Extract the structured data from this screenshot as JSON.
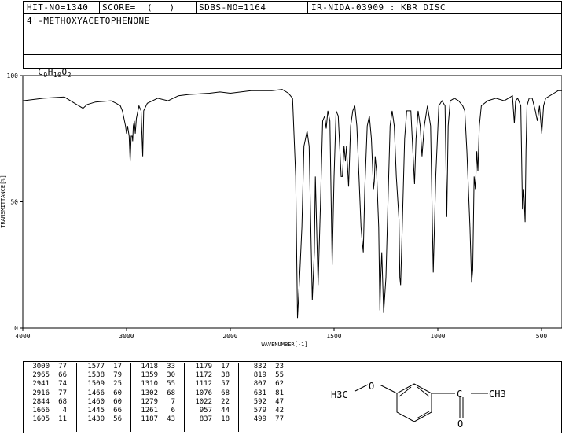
{
  "header": {
    "hit_no": "HIT-NO=1340",
    "score": "SCORE=  (   )",
    "sdbs_no": "SDBS-NO=1164",
    "ir_info": "IR-NIDA-03909 : KBR DISC",
    "compound_name": "4'-METHOXYACETOPHENONE",
    "formula": "C9H10O2"
  },
  "chart_data": {
    "type": "line",
    "title": "",
    "xlabel": "WAVENUMBER[-1]",
    "ylabel": "TRANSMITTANCE[%]",
    "xlim": [
      4000,
      400
    ],
    "ylim": [
      0,
      100
    ],
    "x_ticks": [
      "4000",
      "3000",
      "2000",
      "1500",
      "1000",
      "500"
    ],
    "y_ticks": [
      "100",
      "50",
      "0"
    ],
    "grid": false,
    "series": [
      {
        "points": [
          [
            4000,
            90
          ],
          [
            3800,
            91
          ],
          [
            3600,
            91.5
          ],
          [
            3500,
            89
          ],
          [
            3420,
            87
          ],
          [
            3380,
            88.5
          ],
          [
            3300,
            89.5
          ],
          [
            3150,
            90
          ],
          [
            3100,
            89
          ],
          [
            3060,
            88
          ],
          [
            3040,
            86
          ],
          [
            3010,
            80
          ],
          [
            3000,
            77
          ],
          [
            2990,
            80
          ],
          [
            2975,
            76
          ],
          [
            2965,
            66
          ],
          [
            2955,
            76
          ],
          [
            2945,
            76
          ],
          [
            2941,
            74
          ],
          [
            2935,
            80
          ],
          [
            2925,
            82
          ],
          [
            2916,
            77
          ],
          [
            2905,
            83
          ],
          [
            2880,
            88
          ],
          [
            2860,
            86
          ],
          [
            2844,
            68
          ],
          [
            2835,
            86
          ],
          [
            2800,
            89
          ],
          [
            2700,
            91
          ],
          [
            2600,
            90
          ],
          [
            2500,
            92
          ],
          [
            2400,
            92.5
          ],
          [
            2200,
            93
          ],
          [
            2100,
            93.5
          ],
          [
            2000,
            93
          ],
          [
            1900,
            94
          ],
          [
            1800,
            94
          ],
          [
            1750,
            94.5
          ],
          [
            1720,
            93
          ],
          [
            1700,
            91
          ],
          [
            1685,
            60
          ],
          [
            1676,
            4
          ],
          [
            1666,
            20
          ],
          [
            1655,
            40
          ],
          [
            1645,
            72
          ],
          [
            1630,
            78
          ],
          [
            1620,
            72
          ],
          [
            1605,
            11
          ],
          [
            1595,
            30
          ],
          [
            1590,
            60
          ],
          [
            1577,
            17
          ],
          [
            1565,
            50
          ],
          [
            1555,
            82
          ],
          [
            1545,
            84
          ],
          [
            1538,
            79
          ],
          [
            1530,
            86
          ],
          [
            1520,
            82
          ],
          [
            1509,
            25
          ],
          [
            1500,
            60
          ],
          [
            1490,
            86
          ],
          [
            1480,
            84
          ],
          [
            1466,
            60
          ],
          [
            1460,
            60
          ],
          [
            1452,
            72
          ],
          [
            1445,
            66
          ],
          [
            1440,
            72
          ],
          [
            1430,
            56
          ],
          [
            1420,
            80
          ],
          [
            1410,
            86
          ],
          [
            1400,
            88
          ],
          [
            1390,
            80
          ],
          [
            1380,
            60
          ],
          [
            1370,
            40
          ],
          [
            1365,
            35
          ],
          [
            1359,
            30
          ],
          [
            1352,
            55
          ],
          [
            1340,
            80
          ],
          [
            1330,
            84
          ],
          [
            1320,
            75
          ],
          [
            1310,
            55
          ],
          [
            1306,
            58
          ],
          [
            1302,
            68
          ],
          [
            1295,
            62
          ],
          [
            1285,
            40
          ],
          [
            1279,
            7
          ],
          [
            1275,
            20
          ],
          [
            1270,
            30
          ],
          [
            1261,
            6
          ],
          [
            1250,
            20
          ],
          [
            1240,
            50
          ],
          [
            1230,
            80
          ],
          [
            1220,
            86
          ],
          [
            1210,
            80
          ],
          [
            1200,
            60
          ],
          [
            1187,
            43
          ],
          [
            1183,
            20
          ],
          [
            1179,
            17
          ],
          [
            1172,
            38
          ],
          [
            1160,
            75
          ],
          [
            1150,
            86
          ],
          [
            1130,
            86
          ],
          [
            1120,
            70
          ],
          [
            1112,
            57
          ],
          [
            1105,
            75
          ],
          [
            1095,
            86
          ],
          [
            1085,
            80
          ],
          [
            1076,
            68
          ],
          [
            1065,
            80
          ],
          [
            1050,
            88
          ],
          [
            1035,
            80
          ],
          [
            1022,
            22
          ],
          [
            1010,
            60
          ],
          [
            995,
            88
          ],
          [
            980,
            90
          ],
          [
            965,
            88
          ],
          [
            957,
            44
          ],
          [
            950,
            80
          ],
          [
            940,
            90
          ],
          [
            920,
            91
          ],
          [
            900,
            90
          ],
          [
            880,
            88
          ],
          [
            870,
            86
          ],
          [
            860,
            70
          ],
          [
            845,
            40
          ],
          [
            837,
            18
          ],
          [
            832,
            23
          ],
          [
            825,
            60
          ],
          [
            819,
            55
          ],
          [
            812,
            70
          ],
          [
            807,
            62
          ],
          [
            800,
            80
          ],
          [
            790,
            88
          ],
          [
            760,
            90
          ],
          [
            720,
            91
          ],
          [
            680,
            90
          ],
          [
            660,
            91
          ],
          [
            640,
            92
          ],
          [
            631,
            81
          ],
          [
            625,
            90
          ],
          [
            615,
            91
          ],
          [
            600,
            88
          ],
          [
            592,
            47
          ],
          [
            586,
            55
          ],
          [
            579,
            42
          ],
          [
            575,
            70
          ],
          [
            570,
            88
          ],
          [
            560,
            91
          ],
          [
            545,
            91
          ],
          [
            530,
            86
          ],
          [
            520,
            82
          ],
          [
            510,
            88
          ],
          [
            499,
            77
          ],
          [
            490,
            88
          ],
          [
            480,
            91
          ],
          [
            460,
            92
          ],
          [
            440,
            93
          ],
          [
            420,
            94
          ],
          [
            400,
            94
          ]
        ]
      }
    ]
  },
  "peak_table": {
    "columns": [
      [
        [
          "3000",
          "77"
        ],
        [
          "2965",
          "66"
        ],
        [
          "2941",
          "74"
        ],
        [
          "2916",
          "77"
        ],
        [
          "2844",
          "68"
        ],
        [
          "1666",
          "4"
        ],
        [
          "1605",
          "11"
        ]
      ],
      [
        [
          "1577",
          "17"
        ],
        [
          "1538",
          "79"
        ],
        [
          "1509",
          "25"
        ],
        [
          "1466",
          "60"
        ],
        [
          "1460",
          "60"
        ],
        [
          "1445",
          "66"
        ],
        [
          "1430",
          "56"
        ]
      ],
      [
        [
          "1418",
          "33"
        ],
        [
          "1359",
          "30"
        ],
        [
          "1310",
          "55"
        ],
        [
          "1302",
          "68"
        ],
        [
          "1279",
          "7"
        ],
        [
          "1261",
          "6"
        ],
        [
          "1187",
          "43"
        ]
      ],
      [
        [
          "1179",
          "17"
        ],
        [
          "1172",
          "38"
        ],
        [
          "1112",
          "57"
        ],
        [
          "1076",
          "68"
        ],
        [
          "1022",
          "22"
        ],
        [
          "957",
          "44"
        ],
        [
          "837",
          "18"
        ]
      ],
      [
        [
          "832",
          "23"
        ],
        [
          "819",
          "55"
        ],
        [
          "807",
          "62"
        ],
        [
          "631",
          "81"
        ],
        [
          "592",
          "47"
        ],
        [
          "579",
          "42"
        ],
        [
          "499",
          "77"
        ]
      ]
    ]
  },
  "structure": {
    "left_group": "H3C",
    "left_atom": "O",
    "carbon": "C",
    "right_group": "CH3",
    "carbonyl_o": "O"
  }
}
